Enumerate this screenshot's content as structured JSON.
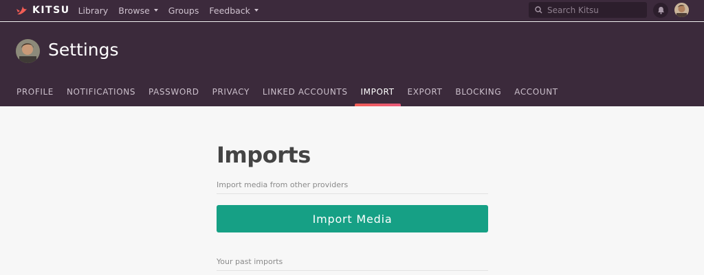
{
  "brand": {
    "name": "KITSU",
    "accent": "#f25d55"
  },
  "nav": {
    "links": [
      {
        "label": "Library",
        "dropdown": false
      },
      {
        "label": "Browse",
        "dropdown": true
      },
      {
        "label": "Groups",
        "dropdown": false
      },
      {
        "label": "Feedback",
        "dropdown": true
      }
    ],
    "search_placeholder": "Search Kitsu"
  },
  "header": {
    "title": "Settings",
    "tabs": [
      "PROFILE",
      "NOTIFICATIONS",
      "PASSWORD",
      "PRIVACY",
      "LINKED ACCOUNTS",
      "IMPORT",
      "EXPORT",
      "BLOCKING",
      "ACCOUNT"
    ],
    "active_tab": "IMPORT"
  },
  "main": {
    "title": "Imports",
    "import_label": "Import media from other providers",
    "import_button": "Import Media",
    "past_label": "Your past imports"
  },
  "colors": {
    "nav_bg": "#3c2a3c",
    "header_bg": "#3b2a3b",
    "button": "#16a085"
  }
}
